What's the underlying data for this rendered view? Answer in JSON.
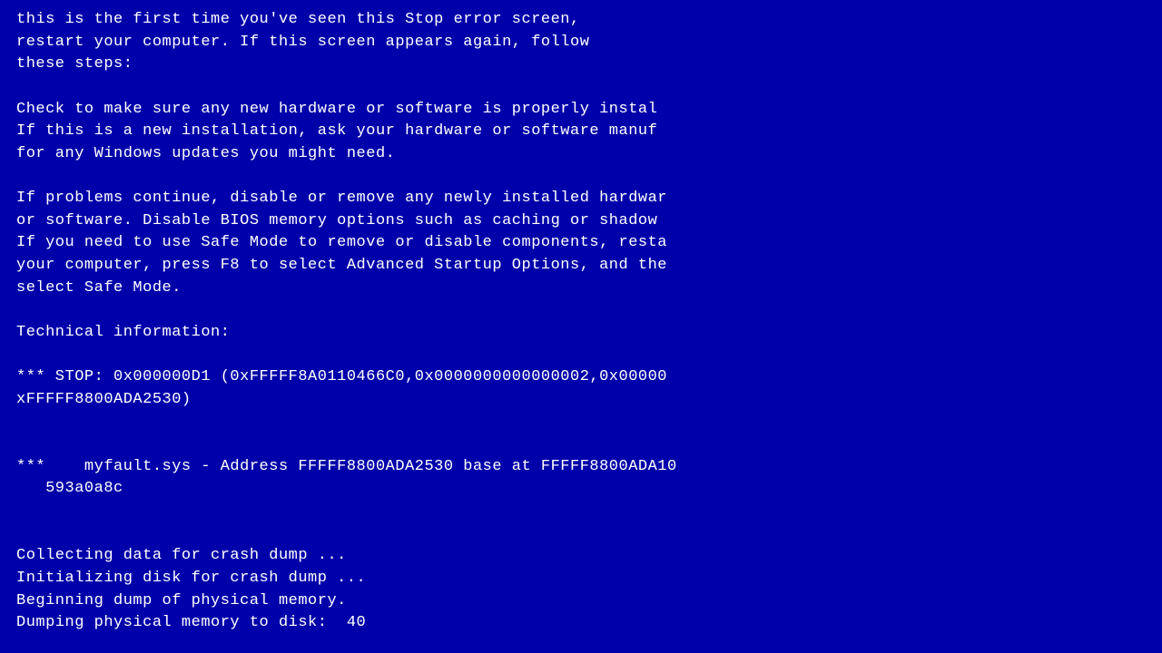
{
  "bsod": {
    "background_color": "#0000AA",
    "text_color": "#FFFFFF",
    "lines": [
      "this is the first time you've seen this Stop error screen,",
      "restart your computer. If this screen appears again, follow",
      "these steps:",
      "",
      "Check to make sure any new hardware or software is properly instal",
      "If this is a new installation, ask your hardware or software manuf",
      "for any Windows updates you might need.",
      "",
      "If problems continue, disable or remove any newly installed hardwar",
      "or software. Disable BIOS memory options such as caching or shadow",
      "If you need to use Safe Mode to remove or disable components, resta",
      "your computer, press F8 to select Advanced Startup Options, and the",
      "select Safe Mode.",
      "",
      "Technical information:",
      "",
      "*** STOP: 0x000000D1 (0xFFFFF8A0110466C0,0x0000000000000002,0x00000",
      "xFFFFF8800ADA2530)",
      "",
      "",
      "***    myfault.sys - Address FFFFF8800ADA2530 base at FFFFF8800ADA10",
      "   593a0a8c",
      "",
      "",
      "Collecting data for crash dump ...",
      "Initializing disk for crash dump ...",
      "Beginning dump of physical memory.",
      "Dumping physical memory to disk:  40"
    ]
  }
}
